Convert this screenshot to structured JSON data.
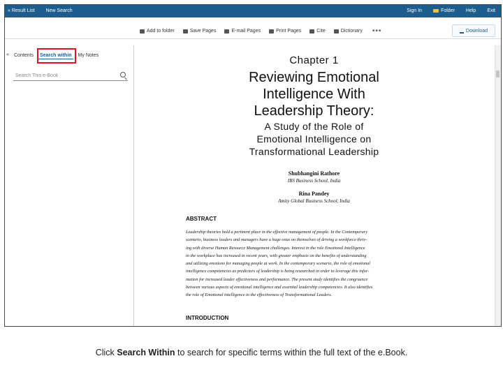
{
  "topbar": {
    "back_link": "« Result List",
    "new_search": "New Search",
    "sign_in": "Sign In",
    "folder": "Folder",
    "help": "Help",
    "exit": "Exit"
  },
  "toolbar": {
    "add_to_folder": "Add to folder",
    "save_pages": "Save Pages",
    "email_pages": "E-mail Pages",
    "print_pages": "Print Pages",
    "cite": "Cite",
    "dictionary": "Dictionary",
    "more": "•••",
    "download": "Download"
  },
  "sidebar": {
    "collapse": "«",
    "tabs": [
      "Contents",
      "Search within",
      "My Notes"
    ],
    "active_tab": "Search within",
    "search_placeholder": "Search This e-Book"
  },
  "document": {
    "chapter": "Chapter 1",
    "title_lines": [
      "Reviewing Emotional",
      "Intelligence With",
      "Leadership Theory:"
    ],
    "subtitle_lines": [
      "A Study of the Role of",
      "Emotional Intelligence on",
      "Transformational Leadership"
    ],
    "authors": [
      {
        "name": "Shubhangini Rathore",
        "affiliation": "IBS Business School, India"
      },
      {
        "name": "Rina Pandey",
        "affiliation": "Amity Global Business School, India"
      }
    ],
    "abstract_heading": "ABSTRACT",
    "abstract_lines": [
      "Leadership theories hold a pertinent place in the effective management of people. In the Contemporary",
      "scenario, business leaders and managers have a huge onus on themselves of driving a workforce thriv-",
      "ing with diverse Human Resource Management challenges. Interest in the role Emotional Intelligence",
      "in the workplace has increased in recent years, with greater emphasis on the benefits of understanding",
      "and utilizing emotions for managing people at work. In the contemporary scenario, the role of emotional",
      "intelligence competencies as predictors of leadership is being researched in order to leverage this infor-",
      "mation for increased leader effectiveness and performance. The present study identifies the congruence",
      "between various aspects of emotional intelligence and essential leadership competencies. It also identifies",
      "the role of Emotional intelligence in the effectiveness of Transformational Leaders."
    ],
    "intro_heading": "INTRODUCTION"
  },
  "caption": {
    "prefix": "Click ",
    "bold": "Search Within",
    "suffix": " to search for specific terms within the full text of the e.Book."
  }
}
